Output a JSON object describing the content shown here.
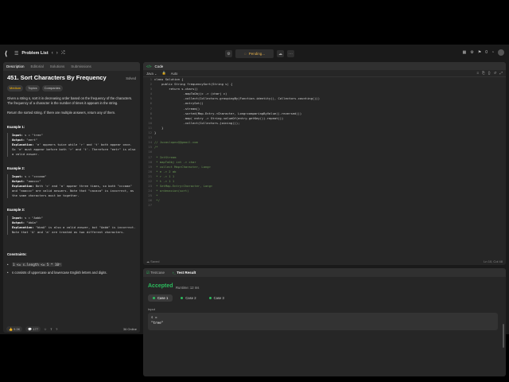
{
  "topbar": {
    "problem_list": "Problem List",
    "pending": "Pending...",
    "count": "0"
  },
  "left": {
    "tabs": [
      "Description",
      "Editorial",
      "Solutions",
      "Submissions"
    ],
    "title": "451. Sort Characters By Frequency",
    "solved": "Solved",
    "difficulty": "Medium",
    "topics": "Topics",
    "companies": "Companies",
    "desc1": "Given a string s, sort it in decreasing order based on the frequency of the characters. The frequency of a character is the number of times it appears in the string.",
    "desc2": "Return the sorted string. If there are multiple answers, return any of them.",
    "examples": [
      {
        "title": "Example 1:",
        "input": "s = \"tree\"",
        "output": "\"eert\"",
        "explanation": "'e' appears twice while 'r' and 't' both appear once. So 'e' must appear before both 'r' and 't'. Therefore \"eetr\" is also a valid answer."
      },
      {
        "title": "Example 2:",
        "input": "s = \"cccaaa\"",
        "output": "\"aaaccc\"",
        "explanation": "Both 'c' and 'a' appear three times, so both \"cccaaa\" and \"aaaccc\" are valid answers. Note that \"cacaca\" is incorrect, as the same characters must be together."
      },
      {
        "title": "Example 3:",
        "input": "s = \"Aabb\"",
        "output": "\"bbAa\"",
        "explanation": "\"bbaA\" is also a valid answer, but \"Aabb\" is incorrect. Note that 'A' and 'a' are treated as two different characters."
      }
    ],
    "constraints_title": "Constraints:",
    "constraints": [
      "1 <= s.length <= 5 * 10⁵",
      "s consists of uppercase and lowercase English letters and digits."
    ],
    "likes": "9.3K",
    "comments": "177",
    "online": "36 Online"
  },
  "code": {
    "title": "Code",
    "lang": "Java",
    "auto": "Auto",
    "saved": "Saved",
    "cursor": "Ln 10, Col 48",
    "lines": [
      "class Solution {",
      "    public String frequencySort(String s) {",
      "        return s.chars()",
      "                .mapToObj(c -> (char) c)",
      "                .collect(Collectors.groupingBy(Function.identity(), Collectors.counting()))",
      "                .entrySet()",
      "                .stream()",
      "                .sorted(Map.Entry.<Character, Long>comparingByValue().reversed())",
      "                .map( entry -> String.valueOf(entry.getKey()).repeat())",
      "                .collect(Collectors.joining());",
      "    }",
      "}",
      "",
      "// Juxaslopez@@gmail.com",
      "/*",
      "",
      " * IntStream",
      " * mapToObj int -> char",
      " * collect Map<Character, Long>",
      " * e -> 2 ab",
      " * r -> 1 1",
      " * t -> 1 1",
      " * SetMap.Entry<Character, Long>",
      " * ordenacion(sort)",
      " *",
      " */",
      ""
    ]
  },
  "test": {
    "tabs": [
      "Testcase",
      "Test Result"
    ],
    "status": "Accepted",
    "runtime": "Runtime: 12 ms",
    "cases": [
      "Case 1",
      "Case 2",
      "Case 3"
    ],
    "input_label": "Input",
    "input_var": "s =",
    "input_value": "\"tree\""
  },
  "colors": {
    "accepted": "#2cbb5d",
    "medium": "#ffb800",
    "pending": "#e6b14a"
  }
}
